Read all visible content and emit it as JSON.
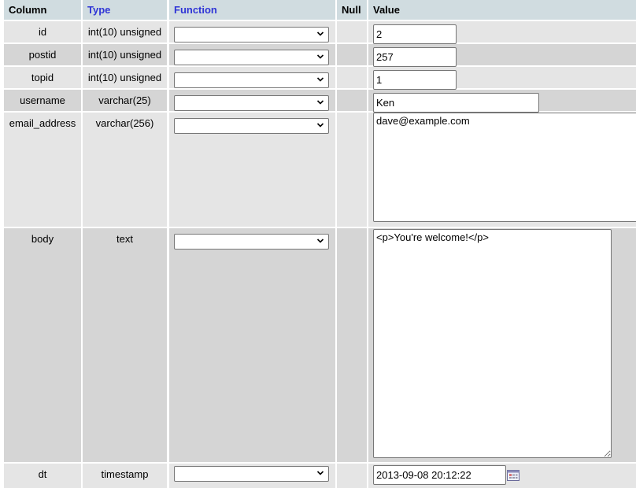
{
  "header": {
    "column": "Column",
    "type": "Type",
    "function": "Function",
    "null": "Null",
    "value": "Value"
  },
  "rows": [
    {
      "column": "id",
      "type": "int(10) unsigned",
      "function": "",
      "value": "2"
    },
    {
      "column": "postid",
      "type": "int(10) unsigned",
      "function": "",
      "value": "257"
    },
    {
      "column": "topid",
      "type": "int(10) unsigned",
      "function": "",
      "value": "1"
    },
    {
      "column": "username",
      "type": "varchar(25)",
      "function": "",
      "value": "Ken"
    },
    {
      "column": "email_address",
      "type": "varchar(256)",
      "function": "",
      "value": "dave@example.com"
    },
    {
      "column": "body",
      "type": "text",
      "function": "",
      "value": "<p>You're welcome!</p>"
    },
    {
      "column": "dt",
      "type": "timestamp",
      "function": "",
      "value": "2013-09-08 20:12:22"
    }
  ],
  "icons": {
    "select_arrow": "chevron-down-icon",
    "datetime_picker": "calendar-icon"
  },
  "colors": {
    "header_bg": "#d0dce0",
    "header_link": "#2f35d6",
    "row_light": "#e5e5e5",
    "row_dark": "#d5d5d5"
  }
}
